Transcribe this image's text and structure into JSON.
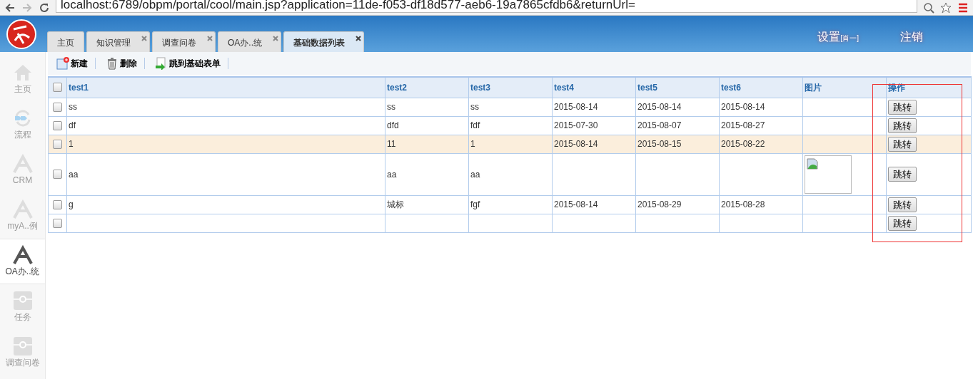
{
  "browser": {
    "address": "localhost:6789/obpm/portal/cool/main.jsp?application=11de-f053-df18d577-aeb6-19a7865cfdb6&returnUrl="
  },
  "header": {
    "tabs": [
      {
        "label": "主页",
        "closable": false,
        "selected": false
      },
      {
        "label": "知识管理",
        "closable": true,
        "selected": false
      },
      {
        "label": "调查问卷",
        "closable": true,
        "selected": false
      },
      {
        "label": "OA办..统",
        "closable": true,
        "selected": false
      },
      {
        "label": "基础数据列表",
        "closable": true,
        "selected": true
      }
    ],
    "settings": "设置",
    "user": "[肖一]",
    "logout": "注销"
  },
  "sidebar": {
    "items": [
      {
        "label": "主页",
        "kind": "home",
        "selected": false
      },
      {
        "label": "流程",
        "kind": "flow",
        "selected": false
      },
      {
        "label": "CRM",
        "kind": "app",
        "selected": false
      },
      {
        "label": "myA..例",
        "kind": "app",
        "selected": false
      },
      {
        "label": "OA办..统",
        "kind": "app",
        "selected": true
      },
      {
        "label": "任务",
        "kind": "module",
        "selected": false
      },
      {
        "label": "调查问卷",
        "kind": "module",
        "selected": false
      }
    ]
  },
  "toolbar": [
    {
      "label": "新建",
      "kind": "new"
    },
    {
      "label": "删除",
      "kind": "delete"
    },
    {
      "label": "跳到基础表单",
      "kind": "goto"
    }
  ],
  "table": {
    "all_checked": false,
    "columns": [
      "test1",
      "test2",
      "test3",
      "test4",
      "test5",
      "test6",
      "图片",
      "操作"
    ],
    "rows": [
      {
        "checked": false,
        "highlighted": false,
        "cells": [
          "ss",
          "ss",
          "ss",
          "2015-08-14",
          "2015-08-14",
          "2015-08-14"
        ],
        "image": false,
        "action": "跳转"
      },
      {
        "checked": false,
        "highlighted": false,
        "cells": [
          "df",
          "dfd",
          "fdf",
          "2015-07-30",
          "2015-08-07",
          "2015-08-27"
        ],
        "image": false,
        "action": "跳转"
      },
      {
        "checked": false,
        "highlighted": true,
        "cells": [
          "1",
          "11",
          "1",
          "2015-08-14",
          "2015-08-15",
          "2015-08-22"
        ],
        "image": false,
        "action": "跳转"
      },
      {
        "checked": false,
        "highlighted": false,
        "cells": [
          "aa",
          "aa",
          "aa",
          "",
          "",
          ""
        ],
        "image": true,
        "action": "跳转"
      },
      {
        "checked": false,
        "highlighted": false,
        "cells": [
          "g",
          "城标",
          "fgf",
          "2015-08-14",
          "2015-08-29",
          "2015-08-28"
        ],
        "image": false,
        "action": "跳转"
      },
      {
        "checked": false,
        "highlighted": false,
        "cells": [
          "",
          "",
          "",
          "",
          "",
          ""
        ],
        "image": false,
        "action": "跳转"
      }
    ]
  }
}
